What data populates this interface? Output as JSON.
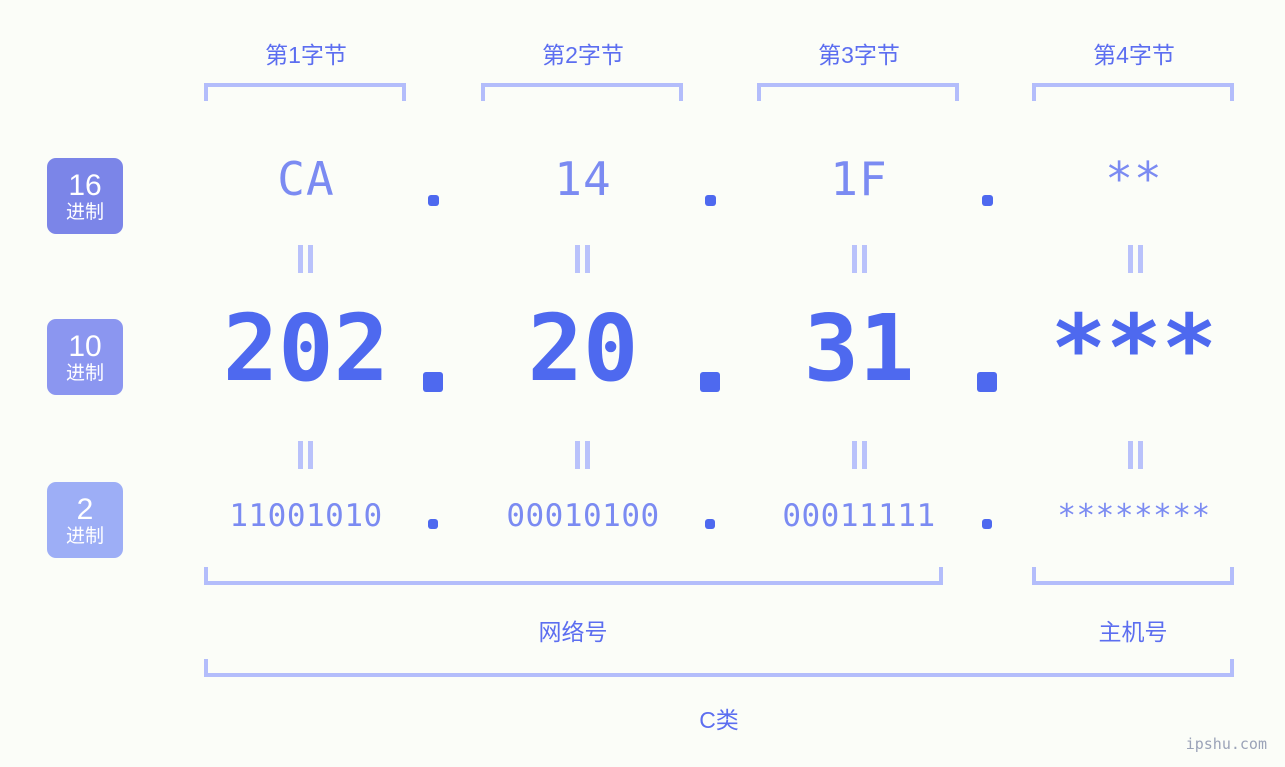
{
  "diagram": {
    "background_color": "#fbfdf8",
    "accent_color": "#4e69ef",
    "light_accent_color": "#7b8bf2",
    "bracket_color": "#b3bdfb"
  },
  "byte_headers": [
    {
      "label": "第1字节"
    },
    {
      "label": "第2字节"
    },
    {
      "label": "第3字节"
    },
    {
      "label": "第4字节"
    }
  ],
  "base_badges": [
    {
      "number": "16",
      "suffix": "进制",
      "color": "#7b85e8"
    },
    {
      "number": "10",
      "suffix": "进制",
      "color": "#8b96f0"
    },
    {
      "number": "2",
      "suffix": "进制",
      "color": "#9daef6"
    }
  ],
  "rows": {
    "hex": {
      "values": [
        "CA",
        "14",
        "1F",
        "**"
      ],
      "separator": "."
    },
    "decimal": {
      "values": [
        "202",
        "20",
        "31",
        "***"
      ],
      "separator": "."
    },
    "binary": {
      "values": [
        "11001010",
        "00010100",
        "00011111",
        "********"
      ],
      "separator": "."
    }
  },
  "equals_symbol": "=",
  "sections": {
    "network": {
      "label": "网络号"
    },
    "host": {
      "label": "主机号"
    },
    "class": {
      "label": "C类"
    }
  },
  "watermark": {
    "text": "ipshu.com"
  }
}
